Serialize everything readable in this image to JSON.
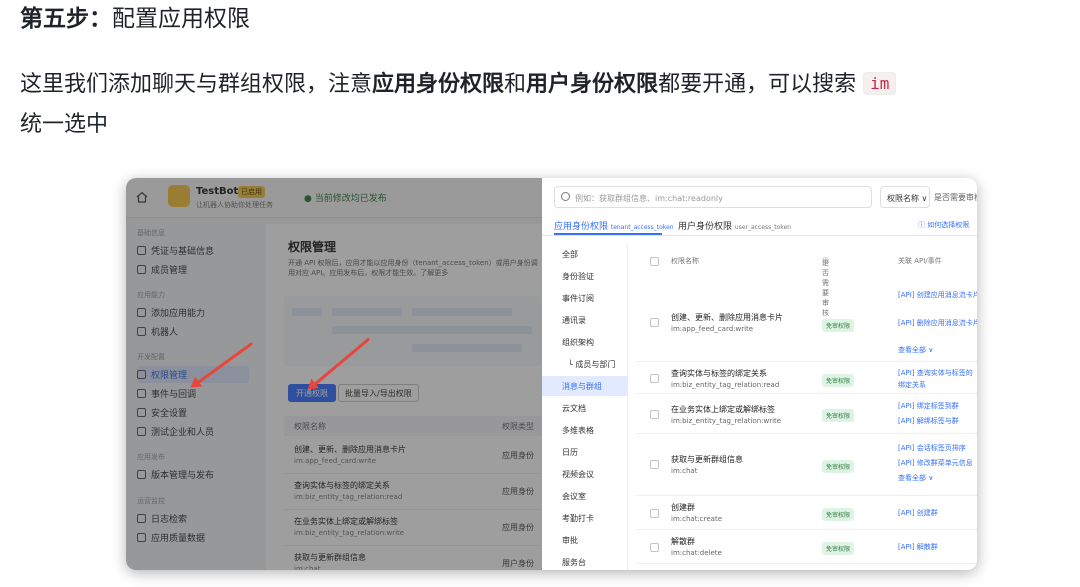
{
  "heading": {
    "step": "第五步：",
    "title": "配置应用权限"
  },
  "description": {
    "part1": "这里我们添加聊天与群组权限，注意",
    "bold1": "应用身份权限",
    "part2": "和",
    "bold2": "用户身份权限",
    "part3": "都要开通，可以搜索",
    "code": "im",
    "part4": "统一选中"
  },
  "console": {
    "app_name": "TestBot",
    "app_badge": "已启用",
    "app_sub": "让机器人协助你处理任务",
    "status": "当前修改均已发布",
    "nav_groups": [
      "基础信息",
      "应用能力",
      "开发配置",
      "应用发布",
      "运营监控"
    ],
    "nav_items": [
      "凭证与基础信息",
      "成员管理",
      "添加应用能力",
      "机器人",
      "权限管理",
      "事件与回调",
      "安全设置",
      "测试企业和人员",
      "版本管理与发布",
      "日志检索",
      "应用质量数据"
    ],
    "content_title": "权限管理",
    "content_desc": "开通 API 权限后，应用才能以应用身份（tenant_access_token）或用户身份调用对应 API。应用发布后，权限才能生效。了解更多",
    "open_button": "开通权限",
    "import_button": "批量导入/导出权限",
    "table_headers": [
      "权限名称",
      "权限类型"
    ],
    "rows": [
      {
        "name": "创建、更新、删除应用消息卡片",
        "key": "im:app_feed_card:write",
        "type": "应用身份"
      },
      {
        "name": "查询实体与标签的绑定关系",
        "key": "im:biz_entity_tag_relation:read",
        "type": "应用身份"
      },
      {
        "name": "在业务实体上绑定或解绑标签",
        "key": "im:biz_entity_tag_relation:write",
        "type": "应用身份"
      },
      {
        "name": "获取与更新群组信息",
        "key": "im:chat",
        "type": "用户身份"
      }
    ]
  },
  "panel": {
    "search_placeholder": "例如：获取群组信息、im:chat:readonly",
    "select_label": "权限名称",
    "select2_label": "是否需要审核",
    "tabs": [
      {
        "label": "应用身份权限",
        "sub": "tenant_access_token"
      },
      {
        "label": "用户身份权限",
        "sub": "user_access_token"
      }
    ],
    "help_link": "如何选择权限",
    "categories": [
      "全部",
      "身份验证",
      "事件订阅",
      "通讯录",
      "组织架构",
      "└ 成员与部门",
      "消息与群组",
      "云文档",
      "多维表格",
      "日历",
      "视频会议",
      "会议室",
      "考勤打卡",
      "审批",
      "服务台"
    ],
    "headers": {
      "name": "权限名称",
      "review": "是否需要审核",
      "api": "关联 API/事件"
    },
    "rows": [
      {
        "name": "创建、更新、删除应用消息卡片",
        "key": "im:app_feed_card:write",
        "tag": "免审权限",
        "apis": [
          "[API] 创建应用消息流卡片",
          "[API] 删除应用消息流卡片",
          "查看全部 ∨"
        ]
      },
      {
        "name": "查询实体与标签的绑定关系",
        "key": "im:biz_entity_tag_relation:read",
        "tag": "免审权限",
        "apis": [
          "[API] 查询实体与标签的",
          "绑定关系"
        ]
      },
      {
        "name": "在业务实体上绑定或解绑标签",
        "key": "im:biz_entity_tag_relation:write",
        "tag": "免审权限",
        "apis": [
          "[API] 绑定标签到群",
          "[API] 解绑标签与群"
        ]
      },
      {
        "name": "获取与更新群组信息",
        "key": "im:chat",
        "tag": "免审权限",
        "apis": [
          "[API] 会话标签页排序",
          "[API] 修改群菜单元信息",
          "查看全部 ∨"
        ]
      },
      {
        "name": "创建群",
        "key": "im:chat:create",
        "tag": "免审权限",
        "apis": [
          "[API] 创建群"
        ]
      },
      {
        "name": "解散群",
        "key": "im:chat:delete",
        "tag": "免审权限",
        "apis": [
          "[API] 解散群"
        ]
      }
    ]
  },
  "colors": {
    "accent": "#3370ff",
    "arrow": "#e8453c",
    "free_tag": "#2f7d44"
  }
}
